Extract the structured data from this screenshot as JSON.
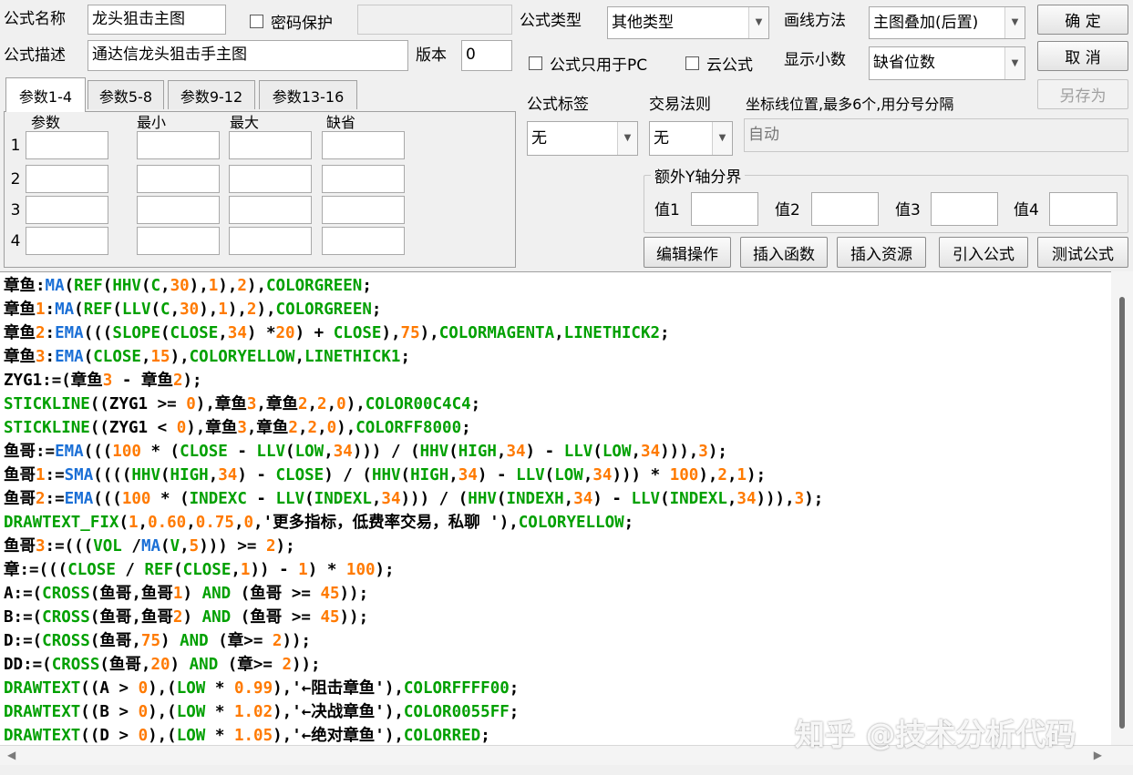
{
  "header": {
    "formula_name_label": "公式名称",
    "formula_name_value": "龙头狙击主图",
    "password_label": "密码保护",
    "password_value": "",
    "formula_desc_label": "公式描述",
    "formula_desc_value": "通达信龙头狙击手主图",
    "version_label": "版本",
    "version_value": "0",
    "formula_type_label": "公式类型",
    "formula_type_value": "其他类型",
    "draw_method_label": "画线方法",
    "draw_method_value": "主图叠加(后置)",
    "pc_only_label": "公式只用于PC",
    "cloud_label": "云公式",
    "decimals_label": "显示小数",
    "decimals_value": "缺省位数"
  },
  "buttons": {
    "confirm": "确  定",
    "cancel": "取  消",
    "save_as": "另存为",
    "edit_ops": "编辑操作",
    "insert_func": "插入函数",
    "insert_res": "插入资源",
    "import_formula": "引入公式",
    "test_formula": "测试公式"
  },
  "tabs": [
    "参数1-4",
    "参数5-8",
    "参数9-12",
    "参数13-16"
  ],
  "params": {
    "headers": [
      "参数",
      "最小",
      "最大",
      "缺省"
    ],
    "rows": [
      "1",
      "2",
      "3",
      "4"
    ]
  },
  "options": {
    "tag_label": "公式标签",
    "tag_value": "无",
    "trade_rule_label": "交易法则",
    "trade_rule_value": "无",
    "axis_label": "坐标线位置,最多6个,用分号分隔",
    "axis_value": "自动",
    "extra_y_label": "额外Y轴分界",
    "v1": "值1",
    "v2": "值2",
    "v3": "值3",
    "v4": "值4"
  },
  "code_lines": [
    "章鱼:MA(REF(HHV(C,30),1),2),COLORGREEN;",
    "章鱼1:MA(REF(LLV(C,30),1),2),COLORGREEN;",
    "章鱼2:EMA(((SLOPE(CLOSE,34) *20) + CLOSE),75),COLORMAGENTA,LINETHICK2;",
    "章鱼3:EMA(CLOSE,15),COLORYELLOW,LINETHICK1;",
    "ZYG1:=(章鱼3 - 章鱼2);",
    "STICKLINE((ZYG1 >= 0),章鱼3,章鱼2,2,0),COLOR00C4C4;",
    "STICKLINE((ZYG1 < 0),章鱼3,章鱼2,2,0),COLORFF8000;",
    "鱼哥:=EMA(((100 * (CLOSE - LLV(LOW,34))) / (HHV(HIGH,34) - LLV(LOW,34))),3);",
    "鱼哥1:=SMA((((HHV(HIGH,34) - CLOSE) / (HHV(HIGH,34) - LLV(LOW,34))) * 100),2,1);",
    "鱼哥2:=EMA(((100 * (INDEXC - LLV(INDEXL,34))) / (HHV(INDEXH,34) - LLV(INDEXL,34))),3);",
    "DRAWTEXT_FIX(1,0.60,0.75,0,'更多指标，低费率交易，私聊 '),COLORYELLOW;",
    "鱼哥3:=(((VOL /MA(V,5))) >= 2);",
    "章:=(((CLOSE / REF(CLOSE,1)) - 1) * 100);",
    "A:=(CROSS(鱼哥,鱼哥1) AND (鱼哥 >= 45));",
    "B:=(CROSS(鱼哥,鱼哥2) AND (鱼哥 >= 45));",
    "D:=(CROSS(鱼哥,75) AND (章>= 2));",
    "DD:=(CROSS(鱼哥,20) AND (章>= 2));",
    "DRAWTEXT((A > 0),(LOW * 0.99),'←阻击章鱼'),COLORFFFF00;",
    "DRAWTEXT((B > 0),(LOW * 1.02),'←决战章鱼'),COLOR0055FF;",
    "DRAWTEXT((D > 0),(LOW * 1.05),'←绝对章鱼'),COLORRED;"
  ],
  "watermark": "知乎 @技术分析代码"
}
